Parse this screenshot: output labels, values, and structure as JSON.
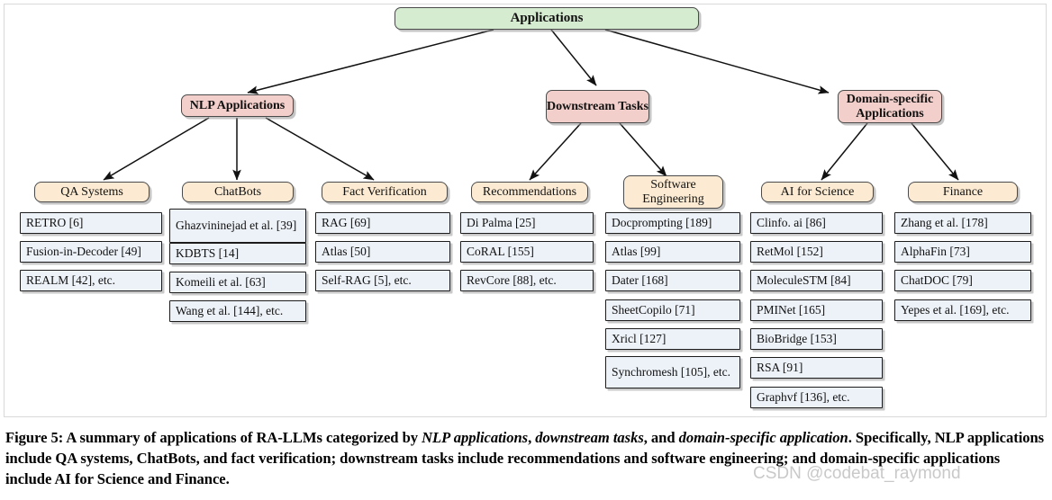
{
  "figure": {
    "root": {
      "label": "Applications",
      "color": "#d5ecd0"
    },
    "branches": [
      {
        "key": "nlp",
        "label": "NLP Applications",
        "color": "#f2cfca",
        "categories": [
          {
            "key": "qa-systems",
            "label": "QA Systems",
            "color": "#fcebd2",
            "items": [
              "RETRO [6]",
              "Fusion-in-Decoder [49]",
              "REALM [42], etc."
            ]
          },
          {
            "key": "chatbots",
            "label": "ChatBots",
            "color": "#fcebd2",
            "items": [
              "Ghazvininejad et al. [39]",
              "KDBTS [14]",
              "Komeili et al. [63]",
              "Wang et al. [144], etc."
            ]
          },
          {
            "key": "fact-verification",
            "label": "Fact Verification",
            "color": "#fcebd2",
            "items": [
              "RAG [69]",
              "Atlas [50]",
              "Self-RAG [5], etc."
            ]
          }
        ]
      },
      {
        "key": "downstream",
        "label": "Downstream Tasks",
        "color": "#f2cfca",
        "categories": [
          {
            "key": "recommendations",
            "label": "Recommendations",
            "color": "#fcebd2",
            "items": [
              "Di Palma [25]",
              "CoRAL [155]",
              "RevCore [88], etc."
            ]
          },
          {
            "key": "software-engineering",
            "label": "Software Engineering",
            "color": "#fcebd2",
            "items": [
              "Docprompting [189]",
              "Atlas [99]",
              "Dater [168]",
              "SheetCopilo [71]",
              "Xricl [127]",
              "Synchromesh [105], etc."
            ]
          }
        ]
      },
      {
        "key": "domain-specific",
        "label": "Domain-specific Applications",
        "color": "#f2cfca",
        "categories": [
          {
            "key": "ai-for-science",
            "label": "AI for Science",
            "color": "#fcebd2",
            "items": [
              "Clinfo. ai [86]",
              "RetMol [152]",
              "MoleculeSTM [84]",
              "PMINet [165]",
              "BioBridge [153]",
              "RSA [91]",
              "Graphvf [136], etc."
            ]
          },
          {
            "key": "finance",
            "label": "Finance",
            "color": "#fcebd2",
            "items": [
              "Zhang et al. [178]",
              "AlphaFin [73]",
              "ChatDOC [79]",
              "Yepes et al. [169], etc."
            ]
          }
        ]
      }
    ]
  },
  "caption": {
    "prefix": "Figure 5: A summary of applications of RA-LLMs categorized by ",
    "em1": "NLP applications",
    "sep1": ", ",
    "em2": "downstream tasks",
    "sep2": ", and ",
    "em3": "domain-specific application",
    "rest": ". Specifically, NLP applications include QA systems, ChatBots, and fact verification; downstream tasks include recommendations and software engineering; and domain-specific applications include AI for Science and Finance."
  },
  "watermark": {
    "text": "CSDN @codebat_raymond",
    "color": "#c9c9c9"
  }
}
